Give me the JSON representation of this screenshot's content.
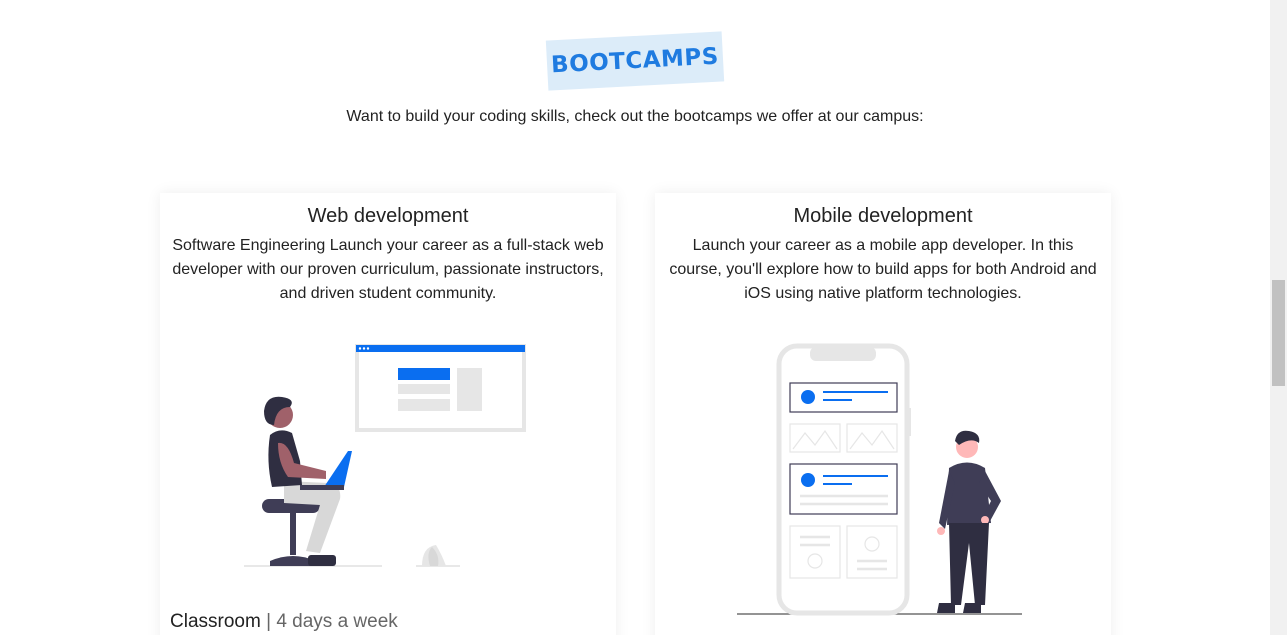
{
  "section": {
    "badge": "BOOTCAMPS",
    "subtitle": "Want to build your coding skills, check out the bootcamps we offer at our campus:"
  },
  "cards": [
    {
      "title": "Web development",
      "description": "Software Engineering Launch your career as a full-stack web developer with our proven curriculum, passionate instructors, and driven student community.",
      "format": "Classroom",
      "separator": "|",
      "schedule": "4 days a week"
    },
    {
      "title": "Mobile development",
      "description": "Launch your career as a mobile app developer. In this course, you'll explore how to build apps for both Android and iOS using native platform technologies."
    }
  ],
  "colors": {
    "accent": "#1f7be0",
    "badge_bg": "#dcecf9",
    "illustration_blue": "#0a6ef0",
    "illustration_dark": "#2f2e41"
  }
}
